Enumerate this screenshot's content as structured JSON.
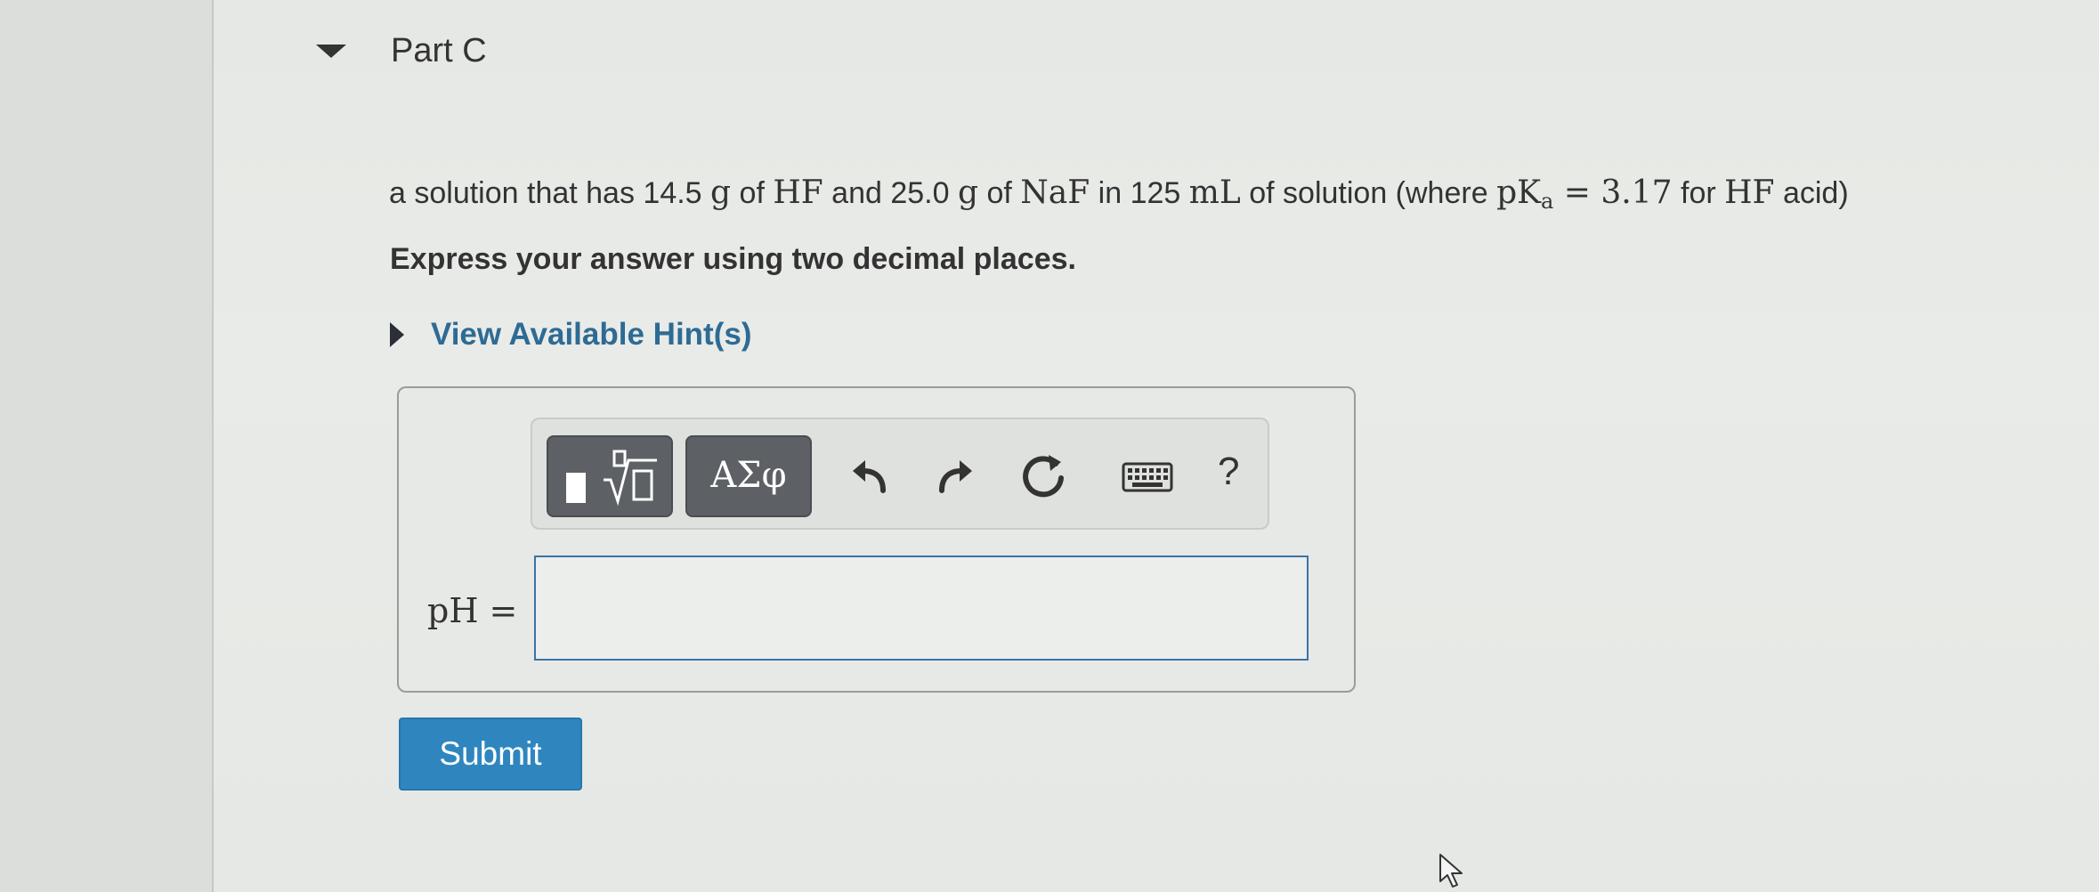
{
  "part": {
    "title": "Part C"
  },
  "question": {
    "text_1": "a solution that has 14.5 ",
    "m_g1": "g",
    "text_2": " of ",
    "m_hf1": "HF",
    "text_3": " and 25.0 ",
    "m_g2": "g",
    "text_4": " of ",
    "m_naf": "NaF",
    "text_5": " in 125 ",
    "m_ml": "mL",
    "text_6": " of solution (where ",
    "m_pk": "pK",
    "m_a": "a",
    "m_eq": " = 3.17",
    "text_7": " for ",
    "m_hf2": "HF",
    "text_8": " acid)"
  },
  "instruction": "Express your answer using two decimal places.",
  "hint": {
    "label": "View Available Hint(s)"
  },
  "toolbar": {
    "greek_label": "ΑΣφ",
    "help_label": "?",
    "icons": [
      "templates-icon",
      "undo-icon",
      "redo-icon",
      "reset-icon",
      "keyboard-icon",
      "help-icon"
    ]
  },
  "answer": {
    "label": "pH =",
    "value": ""
  },
  "submit": {
    "label": "Submit"
  },
  "colors": {
    "link": "#2e6b94",
    "submit": "#2f86bf",
    "input_border": "#3b73a8",
    "toolbar_button": "#5d6064"
  }
}
